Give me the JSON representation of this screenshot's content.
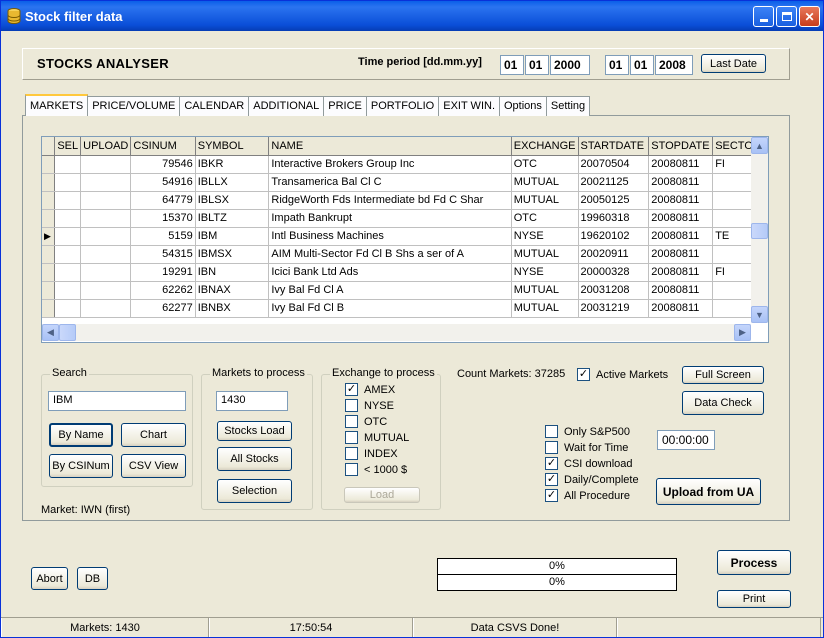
{
  "window": {
    "title": "Stock filter data"
  },
  "header": {
    "app_title": "STOCKS ANALYSER",
    "time_period_label": "Time period [dd.mm.yy]",
    "from": {
      "dd": "01",
      "mm": "01",
      "yy": "2000"
    },
    "to": {
      "dd": "01",
      "mm": "01",
      "yy": "2008"
    },
    "last_date_label": "Last Date"
  },
  "tabs": [
    "MARKETS",
    "PRICE/VOLUME",
    "CALENDAR",
    "ADDITIONAL",
    "PRICE",
    "PORTFOLIO",
    "EXIT WIN.",
    "Options",
    "Setting"
  ],
  "grid": {
    "columns": [
      "",
      "SEL",
      "UPLOAD",
      "CSINUM",
      "SYMBOL",
      "NAME",
      "EXCHANGE",
      "STARTDATE",
      "STOPDATE",
      "SECTO"
    ],
    "rows": [
      {
        "indicator": "",
        "sel": "",
        "upload": "",
        "csinum": "79546",
        "symbol": "IBKR",
        "name": "Interactive Brokers Group Inc",
        "exchange": "OTC",
        "startdate": "20070504",
        "stopdate": "20080811",
        "sector": "FI"
      },
      {
        "indicator": "",
        "sel": "",
        "upload": "",
        "csinum": "54916",
        "symbol": "IBLLX",
        "name": "Transamerica Bal Cl C",
        "exchange": "MUTUAL",
        "startdate": "20021125",
        "stopdate": "20080811",
        "sector": ""
      },
      {
        "indicator": "",
        "sel": "",
        "upload": "",
        "csinum": "64779",
        "symbol": "IBLSX",
        "name": "RidgeWorth Fds Intermediate bd Fd C Shar",
        "exchange": "MUTUAL",
        "startdate": "20050125",
        "stopdate": "20080811",
        "sector": ""
      },
      {
        "indicator": "",
        "sel": "",
        "upload": "",
        "csinum": "15370",
        "symbol": "IBLTZ",
        "name": "Impath Bankrupt",
        "exchange": "OTC",
        "startdate": "19960318",
        "stopdate": "20080811",
        "sector": ""
      },
      {
        "indicator": "▶",
        "sel": "",
        "upload": "",
        "csinum": "5159",
        "symbol": "IBM",
        "name": "Intl Business Machines",
        "exchange": "NYSE",
        "startdate": "19620102",
        "stopdate": "20080811",
        "sector": "TE"
      },
      {
        "indicator": "",
        "sel": "",
        "upload": "",
        "csinum": "54315",
        "symbol": "IBMSX",
        "name": "AIM Multi-Sector Fd Cl B Shs  a ser of A",
        "exchange": "MUTUAL",
        "startdate": "20020911",
        "stopdate": "20080811",
        "sector": ""
      },
      {
        "indicator": "",
        "sel": "",
        "upload": "",
        "csinum": "19291",
        "symbol": "IBN",
        "name": "Icici Bank Ltd Ads",
        "exchange": "NYSE",
        "startdate": "20000328",
        "stopdate": "20080811",
        "sector": "FI"
      },
      {
        "indicator": "",
        "sel": "",
        "upload": "",
        "csinum": "62262",
        "symbol": "IBNAX",
        "name": "Ivy Bal Fd Cl A",
        "exchange": "MUTUAL",
        "startdate": "20031208",
        "stopdate": "20080811",
        "sector": ""
      },
      {
        "indicator": "",
        "sel": "",
        "upload": "",
        "csinum": "62277",
        "symbol": "IBNBX",
        "name": "Ivy Bal Fd Cl B",
        "exchange": "MUTUAL",
        "startdate": "20031219",
        "stopdate": "20080811",
        "sector": ""
      }
    ]
  },
  "search": {
    "group_title": "Search",
    "value": "IBM",
    "by_name": "By Name",
    "chart": "Chart",
    "by_csinum": "By CSINum",
    "csv_view": "CSV View",
    "market_label": "Market: IWN (first)"
  },
  "markets": {
    "group_title": "Markets to process",
    "value": "1430",
    "stocks_load": "Stocks Load",
    "all_stocks": "All Stocks",
    "selection": "Selection"
  },
  "exchange": {
    "group_title": "Exchange to process",
    "options": [
      {
        "label": "AMEX",
        "checked": true
      },
      {
        "label": "NYSE",
        "checked": false
      },
      {
        "label": "OTC",
        "checked": false
      },
      {
        "label": "MUTUAL",
        "checked": false
      },
      {
        "label": "INDEX",
        "checked": false
      },
      {
        "label": "< 1000 $",
        "checked": false
      }
    ],
    "load": "Load"
  },
  "right": {
    "count_markets": "Count Markets: 37285",
    "active_markets": "Active Markets",
    "full_screen": "Full Screen",
    "data_check": "Data Check",
    "only_sp500": "Only S&P500",
    "wait_for_time": "Wait for Time",
    "time_value": "00:00:00",
    "csi_download": "CSI download",
    "daily_complete": "Daily/Complete",
    "all_procedure": "All Procedure",
    "upload_from_ua": "Upload from UA"
  },
  "bottom": {
    "abort": "Abort",
    "db": "DB",
    "progress1": "0%",
    "progress2": "0%",
    "process": "Process",
    "print": "Print"
  },
  "status": {
    "markets": "Markets: 1430",
    "time": "17:50:54",
    "message": "Data CSVS Done!"
  }
}
